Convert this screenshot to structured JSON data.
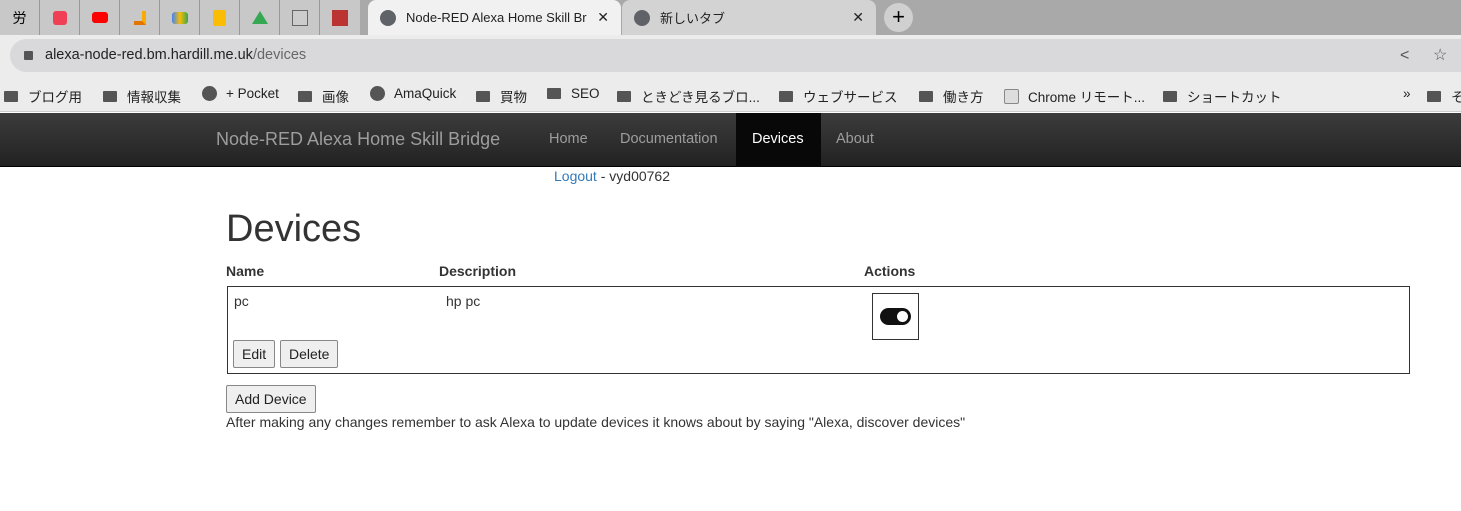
{
  "browser": {
    "pinned_tabs": [
      "労",
      "pocket",
      "youtube",
      "analytics",
      "ads",
      "keep",
      "drive",
      "image",
      "image"
    ],
    "tabs": [
      {
        "title": "Node-RED Alexa Home Skill Br",
        "active": true
      },
      {
        "title": "新しいタブ",
        "active": false
      }
    ],
    "url_host": "alexa-node-red.bm.hardill.me.uk",
    "url_path": "/devices",
    "bookmarks": [
      {
        "label": "ブログ用",
        "icon": "folder"
      },
      {
        "label": "情報収集",
        "icon": "folder"
      },
      {
        "label": "+ Pocket",
        "icon": "globe"
      },
      {
        "label": "画像",
        "icon": "folder"
      },
      {
        "label": "AmaQuick",
        "icon": "globe"
      },
      {
        "label": "買物",
        "icon": "folder"
      },
      {
        "label": "SEO",
        "icon": "folder"
      },
      {
        "label": "ときどき見るブロ...",
        "icon": "folder"
      },
      {
        "label": "ウェブサービス",
        "icon": "folder"
      },
      {
        "label": "働き方",
        "icon": "folder"
      },
      {
        "label": "Chrome リモート...",
        "icon": "chrome-remote"
      },
      {
        "label": "ショートカット",
        "icon": "folder"
      }
    ],
    "overflow": "»",
    "last_bookmark": "そ"
  },
  "nav": {
    "brand": "Node-RED Alexa Home Skill Bridge",
    "items": [
      "Home",
      "Documentation",
      "Devices",
      "About"
    ],
    "active": "Devices"
  },
  "user": {
    "logout": "Logout",
    "separator": " - ",
    "username": "vyd00762"
  },
  "page": {
    "title": "Devices",
    "columns": [
      "Name",
      "Description",
      "Actions"
    ],
    "devices": [
      {
        "name": "pc",
        "description": "hp pc",
        "enabled": true,
        "edit": "Edit",
        "delete": "Delete"
      }
    ],
    "add_button": "Add Device",
    "note": "After making any changes remember to ask Alexa to update devices it knows about by saying \"Alexa, discover devices\""
  }
}
